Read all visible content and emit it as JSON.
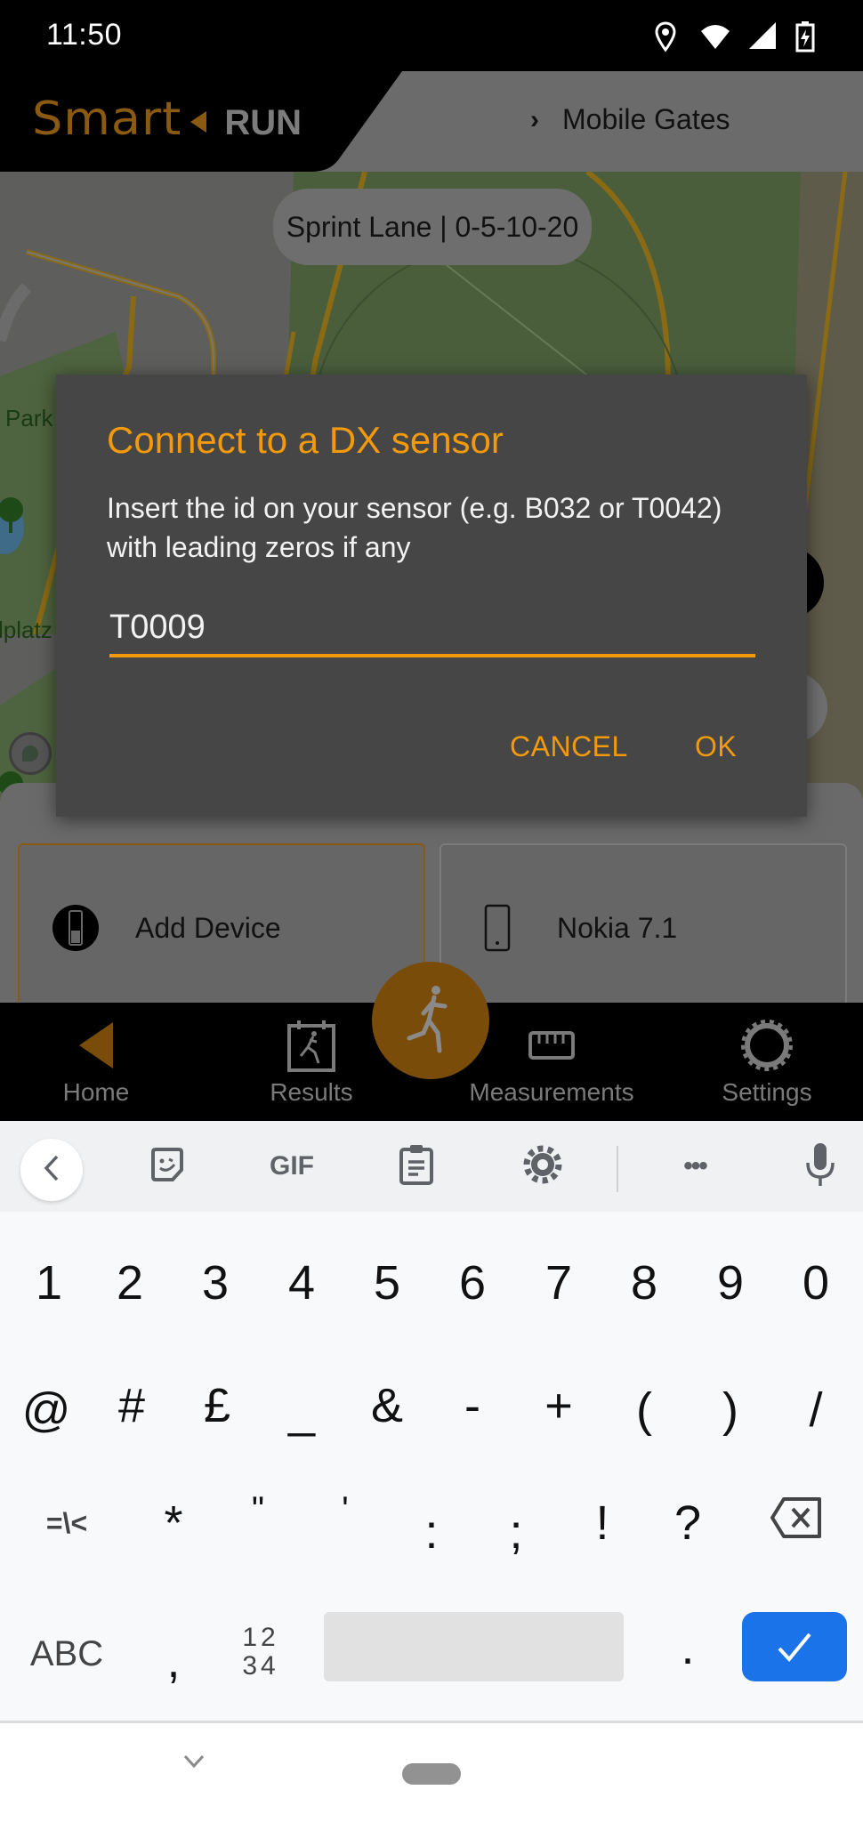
{
  "status_bar": {
    "time": "11:50",
    "icons": [
      "location-icon",
      "wifi-icon",
      "cell-signal-icon",
      "battery-charging-icon"
    ]
  },
  "header": {
    "logo_primary": "Smart",
    "logo_secondary": "RUN",
    "breadcrumb": "Mobile Gates"
  },
  "map": {
    "route_label": "Sprint Lane | 0-5-10-20",
    "place_labels": [
      "Park",
      "lplatz"
    ]
  },
  "devices": [
    {
      "label": "Add Device",
      "icon": "sensor-icon",
      "selected": true
    },
    {
      "label": "Nokia 7.1",
      "icon": "phone-icon",
      "selected": false
    }
  ],
  "bottom_nav": {
    "items": [
      {
        "label": "Home",
        "icon": "home-arrow-icon",
        "active": true
      },
      {
        "label": "Results",
        "icon": "results-icon",
        "active": false
      },
      {
        "label": "Measurements",
        "icon": "ruler-icon",
        "active": false
      },
      {
        "label": "Settings",
        "icon": "gear-icon",
        "active": false
      }
    ],
    "fab_icon": "runner-icon"
  },
  "dialog": {
    "title": "Connect to a DX sensor",
    "message": "Insert the id on your sensor (e.g. B032 or T0042) with leading zeros if any",
    "input_value": "T0009",
    "cancel_label": "CANCEL",
    "ok_label": "OK",
    "accent_color": "#f39a0c"
  },
  "keyboard": {
    "toolbar": [
      "back-icon",
      "sticker-icon",
      "GIF",
      "clipboard-icon",
      "settings-icon",
      "more-icon",
      "mic-icon"
    ],
    "gif_label": "GIF",
    "more_label": "•••",
    "rows": [
      [
        "1",
        "2",
        "3",
        "4",
        "5",
        "6",
        "7",
        "8",
        "9",
        "0"
      ],
      [
        "@",
        "#",
        "£",
        "_",
        "&",
        "-",
        "+",
        "(",
        ")",
        "/"
      ],
      [
        "=\\<",
        "*",
        "\"",
        "'",
        ":",
        ";",
        "!",
        "?"
      ],
      [
        "ABC",
        ",",
        "12\n34",
        ".",
        "✓"
      ]
    ],
    "abc_label": "ABC",
    "comma_label": ",",
    "numpad_label_top": "12",
    "numpad_label_bottom": "34",
    "period_label": ".",
    "enter_color": "#1a73e8"
  }
}
